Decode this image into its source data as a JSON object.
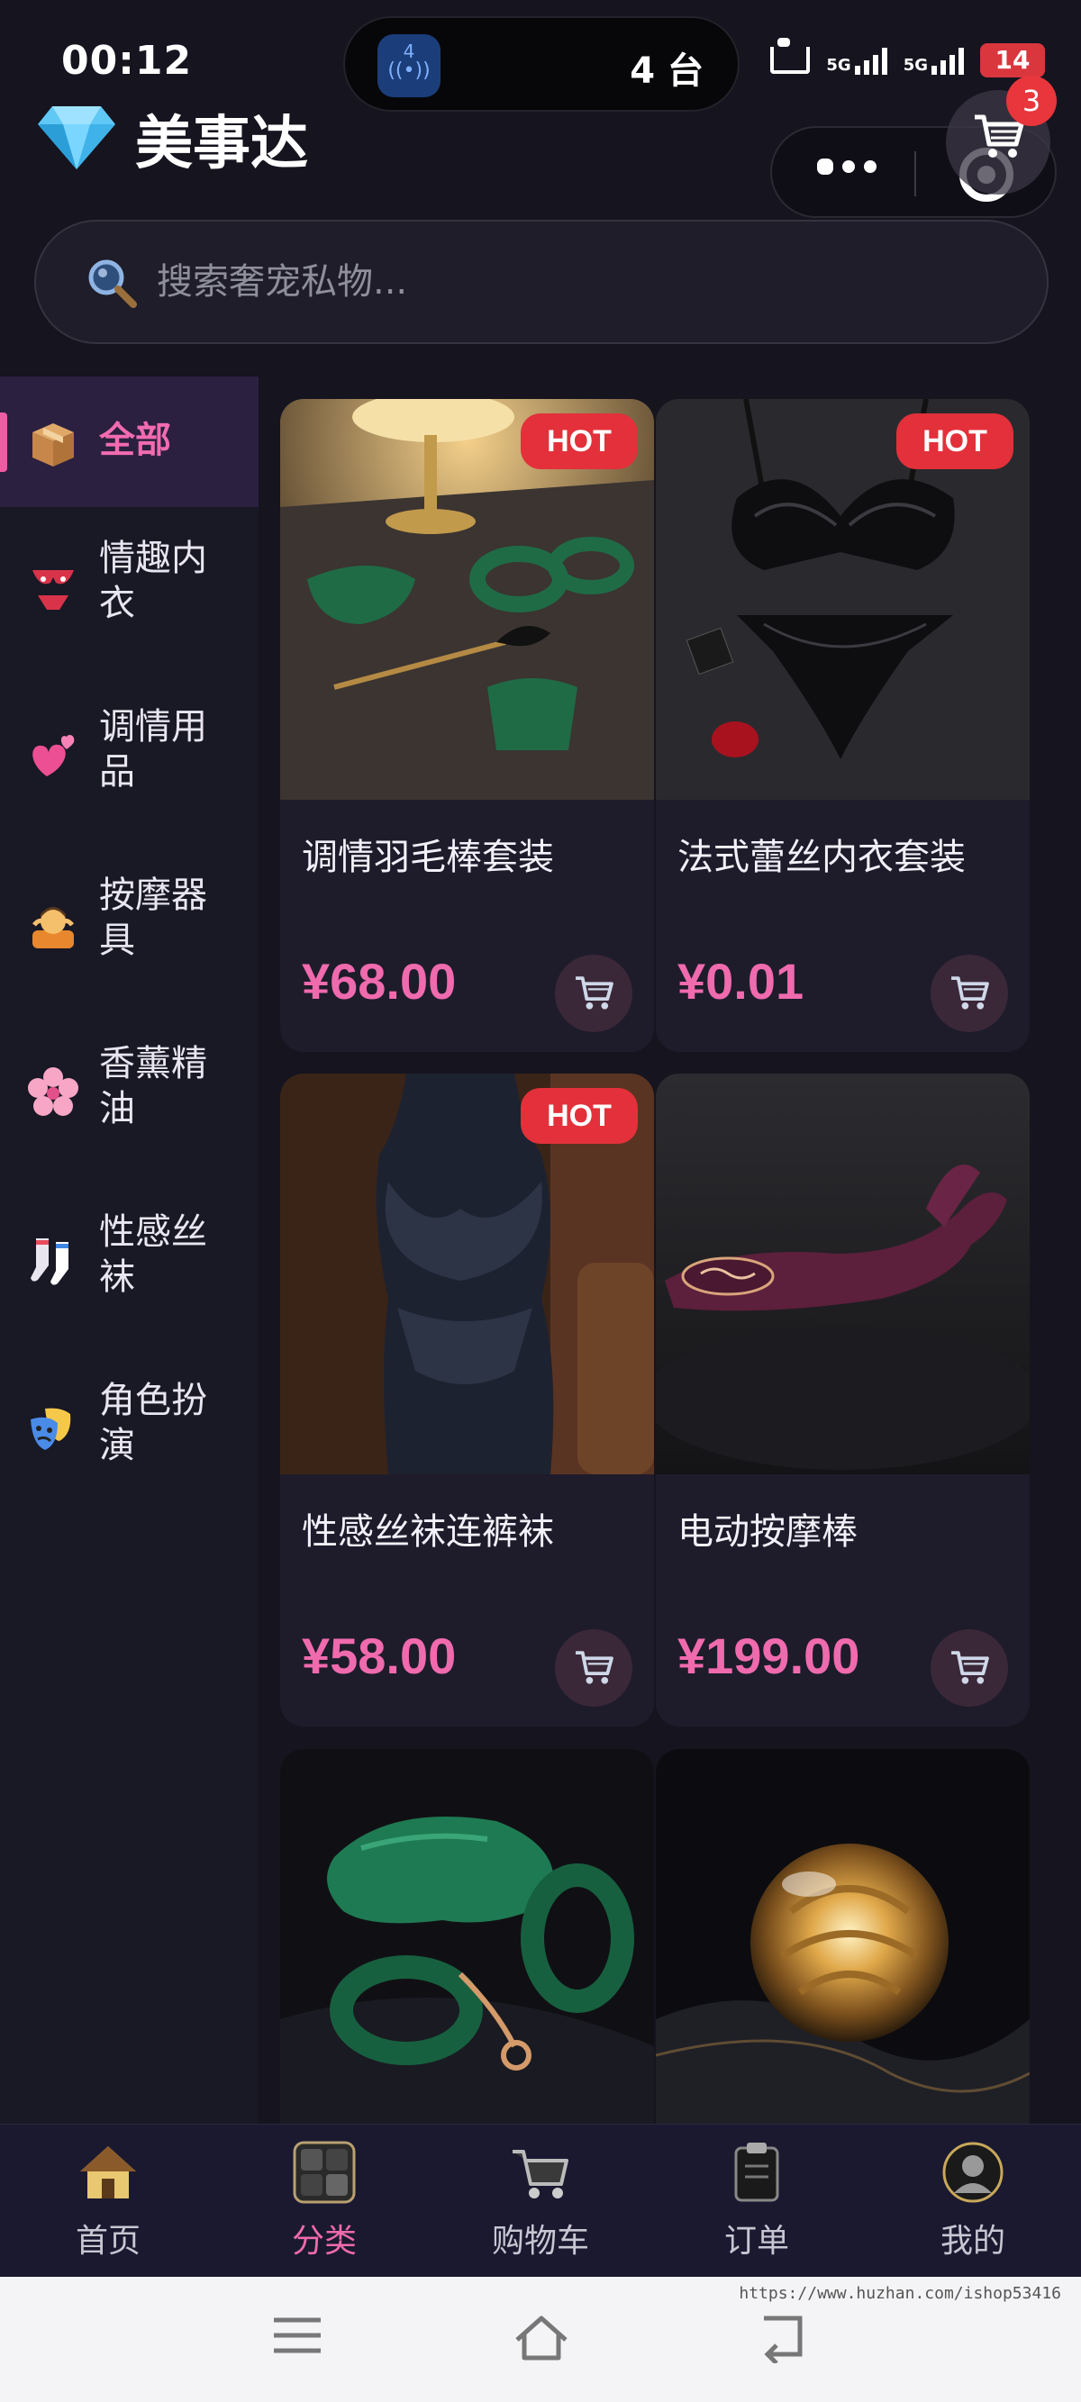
{
  "status_bar": {
    "time": "00:12",
    "island_text": "4 台",
    "island_app_badge": "4",
    "signal_1": "5G",
    "signal_2": "5G",
    "battery": "14"
  },
  "header": {
    "title": "美事达",
    "cart_count": "3"
  },
  "search": {
    "placeholder": "搜索奢宠私物..."
  },
  "categories": [
    {
      "emoji": "📦",
      "label": "全部",
      "active": true
    },
    {
      "emoji": "👙",
      "label": "情趣内衣"
    },
    {
      "emoji": "💕",
      "label": "调情用品"
    },
    {
      "emoji": "💆",
      "label": "按摩器具"
    },
    {
      "emoji": "🌸",
      "label": "香薰精油"
    },
    {
      "emoji": "🧦",
      "label": "性感丝袜"
    },
    {
      "emoji": "🎭",
      "label": "角色扮演"
    }
  ],
  "products": [
    {
      "name": "调情羽毛棒套装",
      "price": "¥68.00",
      "badge": "HOT"
    },
    {
      "name": "法式蕾丝内衣套装",
      "price": "¥0.01",
      "badge": "HOT"
    },
    {
      "name": "性感丝袜连裤袜",
      "price": "¥58.00",
      "badge": "HOT"
    },
    {
      "name": "电动按摩棒",
      "price": "¥199.00",
      "badge": ""
    },
    {
      "name": "",
      "price": "",
      "badge": ""
    },
    {
      "name": "",
      "price": "",
      "badge": ""
    }
  ],
  "tabbar": {
    "items": [
      {
        "label": "首页"
      },
      {
        "label": "分类"
      },
      {
        "label": "购物车"
      },
      {
        "label": "订单"
      },
      {
        "label": "我的"
      }
    ]
  },
  "watermark": "https://www.huzhan.com/ishop53416",
  "colors": {
    "accent": "#f06aae",
    "hot_badge": "#e3303a",
    "background": "#15141f",
    "sidebar": "#191825",
    "card": "#1e1c2b"
  }
}
